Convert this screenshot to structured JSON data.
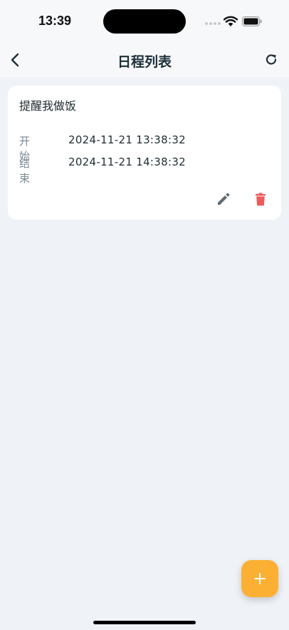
{
  "status_bar": {
    "time": "13:39",
    "icons": [
      "cellular-signal-icon",
      "wifi-icon",
      "battery-icon"
    ]
  },
  "nav": {
    "title": "日程列表",
    "back_icon": "chevron-left-icon",
    "refresh_icon": "refresh-icon"
  },
  "schedules": [
    {
      "title": "提醒我做饭",
      "start_label": "开始",
      "start_time": "2024-11-21 13:38:32",
      "end_label": "结束",
      "end_time": "2024-11-21 14:38:32",
      "actions": [
        "edit-icon",
        "delete-icon"
      ]
    }
  ],
  "fab": {
    "icon": "plus-icon",
    "symbol": "+"
  },
  "colors": {
    "background": "#eff2f6",
    "header": "#f7f8fa",
    "card": "#ffffff",
    "title_text": "#1d3038",
    "label_text": "#7d8a91",
    "edit_icon": "#5f6b72",
    "delete_icon": "#ee5b5b",
    "fab": "#fbb034"
  }
}
